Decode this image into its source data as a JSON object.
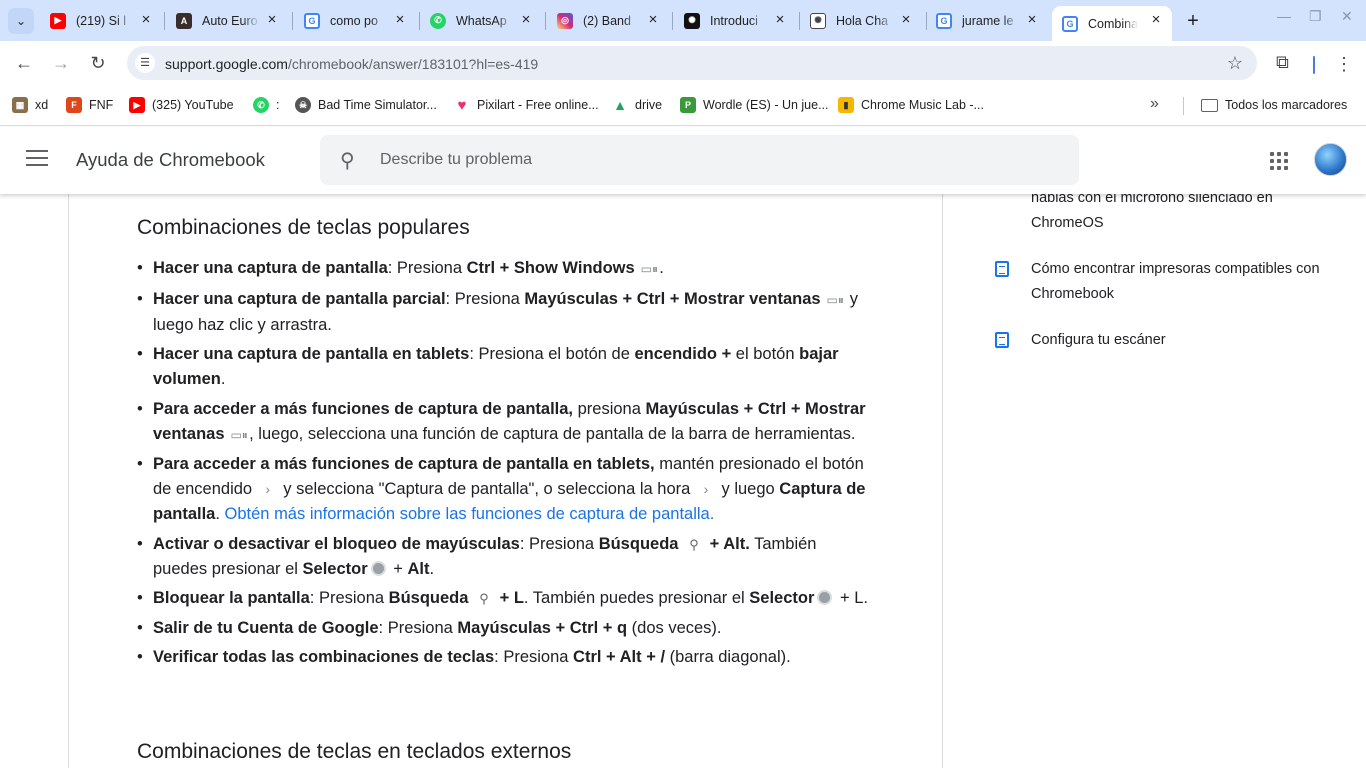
{
  "browser": {
    "tabs": [
      {
        "label": "(219) Si l",
        "favicon": "youtube-icon",
        "color": "#ff0000",
        "active": false
      },
      {
        "label": "Auto Euro",
        "favicon": "auto-euro-icon",
        "color": "#3a2d2d",
        "active": false
      },
      {
        "label": "como po",
        "favicon": "google-icon",
        "color": "#4285f4",
        "active": false
      },
      {
        "label": "WhatsAp",
        "favicon": "whatsapp-icon",
        "color": "#25d366",
        "active": false
      },
      {
        "label": "(2) Band",
        "favicon": "instagram-icon",
        "color": "#d62976",
        "active": false
      },
      {
        "label": "Introduci",
        "favicon": "openai-icon",
        "color": "#111111",
        "active": false
      },
      {
        "label": "Hola Cha",
        "favicon": "openai-icon",
        "color": "#6e6e6e",
        "active": false
      },
      {
        "label": "jurame le",
        "favicon": "google-icon",
        "color": "#4285f4",
        "active": false
      },
      {
        "label": "Combina",
        "favicon": "google-icon",
        "color": "#4285f4",
        "active": true
      }
    ],
    "new_tab": "+",
    "url_domain": "support.google.com",
    "url_path": "/chromebook/answer/183101?hl=es-419",
    "bookmarks": [
      {
        "label": "xd",
        "icon": "folder-image-icon",
        "color": "#8a6d4b"
      },
      {
        "label": "FNF",
        "icon": "fnf-icon",
        "color": "#e0461b"
      },
      {
        "label": "(325) YouTube",
        "icon": "youtube-icon",
        "color": "#ff0000"
      },
      {
        "label": ":",
        "icon": "whatsapp-icon",
        "color": "#25d366"
      },
      {
        "label": "Bad Time Simulator...",
        "icon": "skull-icon",
        "color": "#555555"
      },
      {
        "label": "Pixilart - Free online...",
        "icon": "heart-icon",
        "color": "#e8336d"
      },
      {
        "label": "drive",
        "icon": "drive-icon",
        "color": "#1fa463"
      },
      {
        "label": "Wordle (ES) - Un jue...",
        "icon": "wordle-icon",
        "color": "#3a9a3a"
      },
      {
        "label": "Chrome Music Lab -...",
        "icon": "music-lab-icon",
        "color": "#f5b700"
      }
    ],
    "all_bookmarks": "Todos los marcadores"
  },
  "help": {
    "title": "Ayuda de Chromebook",
    "search_placeholder": "Describe tu problema"
  },
  "article": {
    "heading": "Combinaciones de teclas populares",
    "heading2": "Combinaciones de teclas en teclados externos",
    "items": [
      {
        "b1": "Hacer una captura de pantalla",
        "t1": ": Presiona ",
        "b2": "Ctrl + Show Windows",
        "t2": "."
      },
      {
        "b1": "Hacer una captura de pantalla parcial",
        "t1": ": Presiona ",
        "b2": "Mayúsculas + Ctrl + Mostrar ventanas",
        "t2": " y luego haz clic y arrastra."
      },
      {
        "b1": "Hacer una captura de pantalla en tablets",
        "t1": ": Presiona el botón de ",
        "b2": "encendido +",
        "t2": " el botón ",
        "b3": "bajar volumen",
        "t3": "."
      },
      {
        "b1": "Para acceder a más funciones de captura de pantalla,",
        "t1": " presiona ",
        "b2": "Mayúsculas + Ctrl + Mostrar ventanas",
        "t2": ", luego, selecciona una función de captura de pantalla de la barra de herramientas."
      },
      {
        "b1": "Para acceder a más funciones de captura de pantalla en tablets,",
        "t1": " mantén presionado el botón de encendido ",
        "t2": " y selecciona \"Captura de pantalla\", o selecciona la hora ",
        "t3": " y luego ",
        "b2": "Captura de pantalla",
        "t4": ". ",
        "link": "Obtén más información sobre las funciones de captura de pantalla."
      },
      {
        "b1": "Activar o desactivar el bloqueo de mayúsculas",
        "t1": ": Presiona ",
        "b2": "Búsqueda",
        "b3": " + Alt.",
        "t2": " También puedes presionar el ",
        "b4": "Selector",
        "t3": " + ",
        "b5": "Alt",
        "t4": "."
      },
      {
        "b1": "Bloquear la pantalla",
        "t1": ": Presiona ",
        "b2": "Búsqueda",
        "b3": " + L",
        "t2": ". También puedes presionar el ",
        "b4": "Selector",
        "t3": " + L."
      },
      {
        "b1": "Salir de tu Cuenta de Google",
        "t1": ": Presiona ",
        "b2": "Mayúsculas + Ctrl + q",
        "t2": " (dos veces)."
      },
      {
        "b1": "Verificar todas las combinaciones de teclas",
        "t1": ": Presiona ",
        "b2": "Ctrl + Alt + /",
        "t2": " (barra diagonal)."
      }
    ]
  },
  "related": {
    "partial_item": "hablas con el micrófono silenciado en ChromeOS",
    "items": [
      "Cómo encontrar impresoras compatibles con Chromebook",
      "Configura tu escáner"
    ]
  }
}
